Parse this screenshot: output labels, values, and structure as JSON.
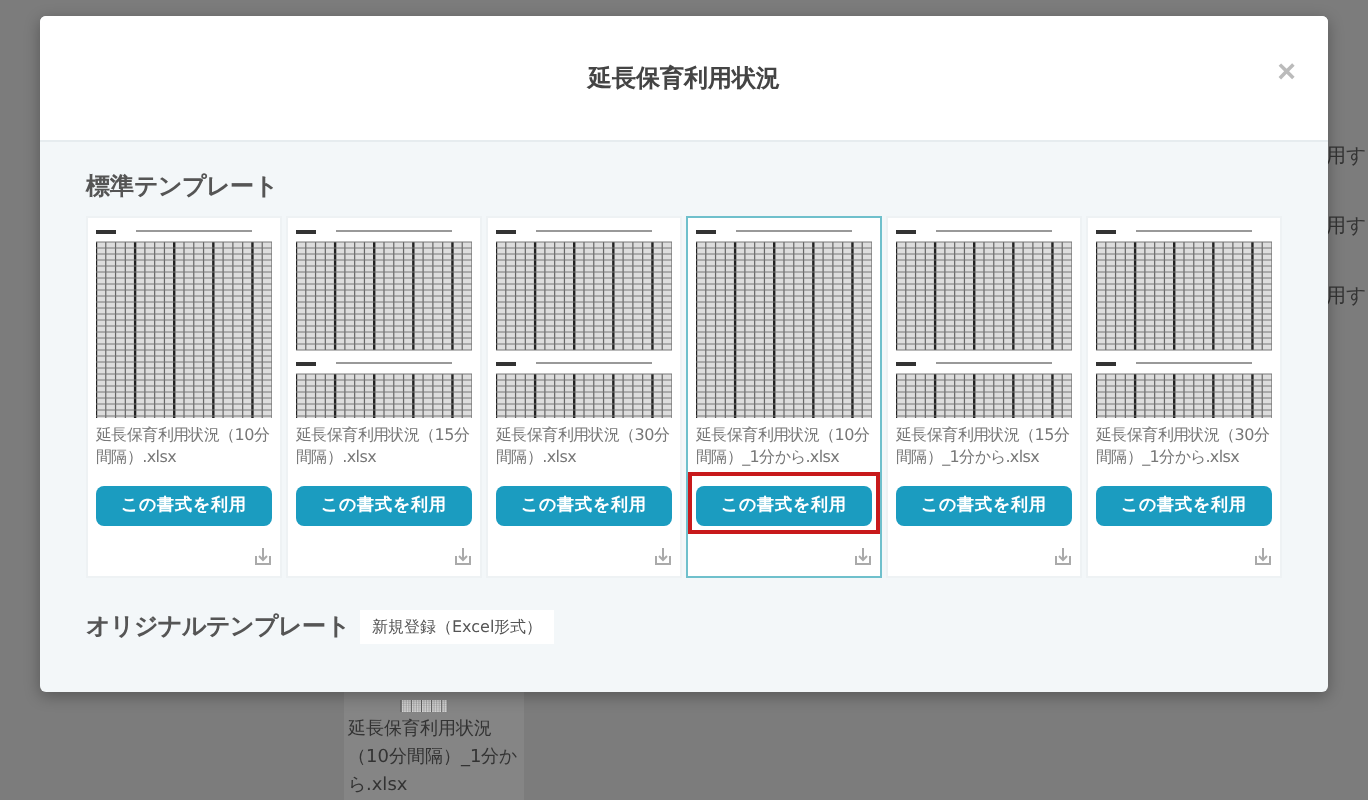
{
  "background": {
    "side_texts": [
      "用す",
      "用す",
      "用す"
    ],
    "file_card": {
      "name": "延長保育利用状況（10分間隔）_1分から.xlsx"
    }
  },
  "dialog": {
    "title": "延長保育利用状況",
    "close": "×",
    "standard_section": {
      "heading": "標準テンプレート",
      "templates": [
        {
          "name": "延長保育利用状況（10分間隔）.xlsx",
          "split": false,
          "selected": false,
          "highlighted": false,
          "button": "この書式を利用"
        },
        {
          "name": "延長保育利用状況（15分間隔）.xlsx",
          "split": true,
          "selected": false,
          "highlighted": false,
          "button": "この書式を利用"
        },
        {
          "name": "延長保育利用状況（30分間隔）.xlsx",
          "split": true,
          "selected": false,
          "highlighted": false,
          "button": "この書式を利用"
        },
        {
          "name": "延長保育利用状況（10分間隔）_1分から.xlsx",
          "split": false,
          "selected": true,
          "highlighted": true,
          "button": "この書式を利用"
        },
        {
          "name": "延長保育利用状況（15分間隔）_1分から.xlsx",
          "split": true,
          "selected": false,
          "highlighted": false,
          "button": "この書式を利用"
        },
        {
          "name": "延長保育利用状況（30分間隔）_1分から.xlsx",
          "split": true,
          "selected": false,
          "highlighted": false,
          "button": "この書式を利用"
        }
      ]
    },
    "original_section": {
      "heading": "オリジナルテンプレート",
      "register_button": "新規登録（Excel形式）"
    }
  }
}
